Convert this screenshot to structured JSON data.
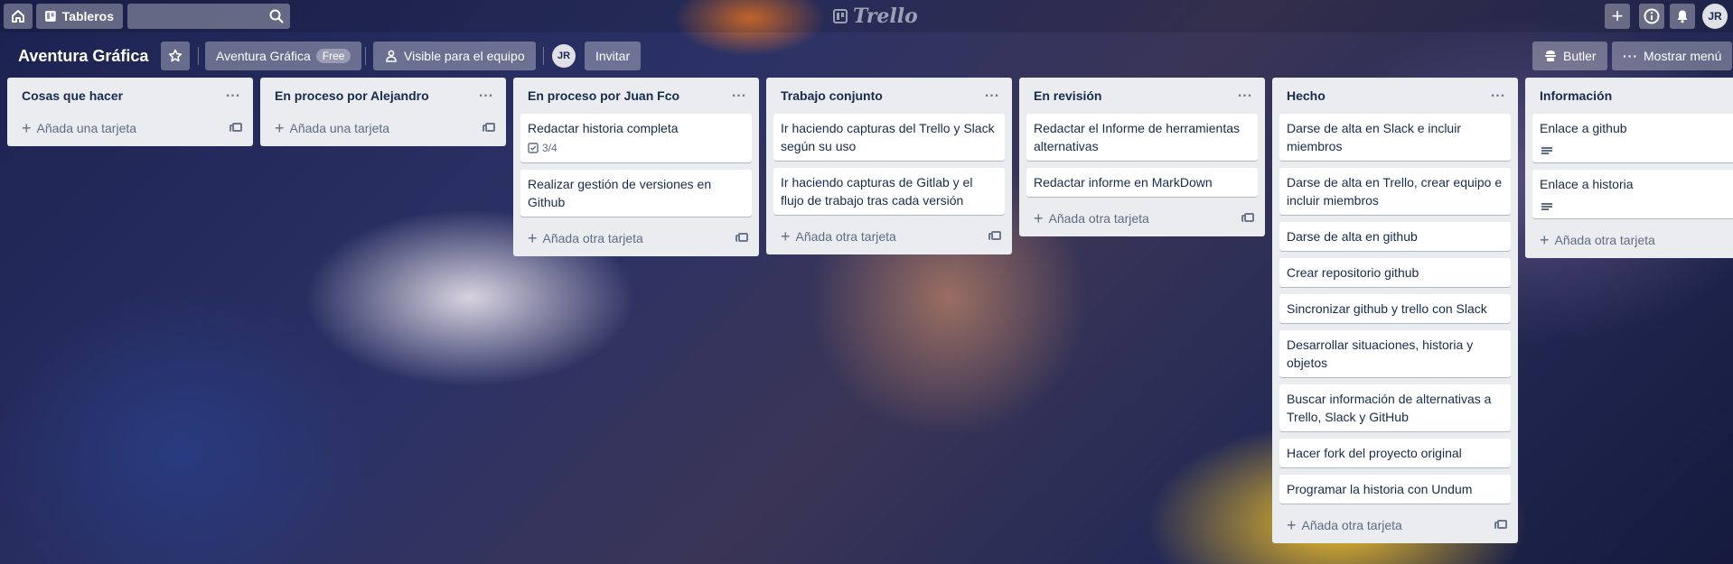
{
  "topbar": {
    "home_icon": "home-icon",
    "boards_label": "Tableros",
    "search_value": "",
    "logo_text": "Trello",
    "avatar": "JR"
  },
  "board": {
    "title": "Aventura Gráfica",
    "team_name": "Aventura Gráfica",
    "plan_badge": "Free",
    "visibility_label": "Visible para el equipo",
    "member_avatar": "JR",
    "invite_label": "Invitar",
    "butler_label": "Butler",
    "menu_label": "Mostrar menú"
  },
  "lists": [
    {
      "title": "Cosas que hacer",
      "cards": [],
      "add_label": "Añada una tarjeta"
    },
    {
      "title": "En proceso por Alejandro",
      "cards": [],
      "add_label": "Añada una tarjeta"
    },
    {
      "title": "En proceso por Juan Fco",
      "cards": [
        {
          "text": "Redactar historia completa",
          "checklist": "3/4"
        },
        {
          "text": "Realizar gestión de versiones en Github"
        }
      ],
      "add_label": "Añada otra tarjeta"
    },
    {
      "title": "Trabajo conjunto",
      "cards": [
        {
          "text": "Ir haciendo capturas del Trello y Slack según su uso"
        },
        {
          "text": "Ir haciendo capturas de Gitlab y el flujo de trabajo tras cada versión"
        }
      ],
      "add_label": "Añada otra tarjeta"
    },
    {
      "title": "En revisión",
      "cards": [
        {
          "text": "Redactar el Informe de herramientas alternativas"
        },
        {
          "text": "Redactar informe en MarkDown"
        }
      ],
      "add_label": "Añada otra tarjeta"
    },
    {
      "title": "Hecho",
      "cards": [
        {
          "text": "Darse de alta en Slack e incluir miembros"
        },
        {
          "text": "Darse de alta en Trello, crear equipo e incluir miembros"
        },
        {
          "text": "Darse de alta en github"
        },
        {
          "text": "Crear repositorio github"
        },
        {
          "text": "Sincronizar github y trello con Slack"
        },
        {
          "text": "Desarrollar situaciones, historia y objetos"
        },
        {
          "text": "Buscar información de alternativas a Trello, Slack y GitHub"
        },
        {
          "text": "Hacer fork del proyecto original"
        },
        {
          "text": "Programar la historia con Undum"
        }
      ],
      "add_label": "Añada otra tarjeta"
    },
    {
      "title": "Información",
      "cards": [
        {
          "text": "Enlace a github",
          "has_description": true
        },
        {
          "text": "Enlace a historia",
          "has_description": true
        }
      ],
      "add_label": "Añada otra tarjeta"
    }
  ]
}
